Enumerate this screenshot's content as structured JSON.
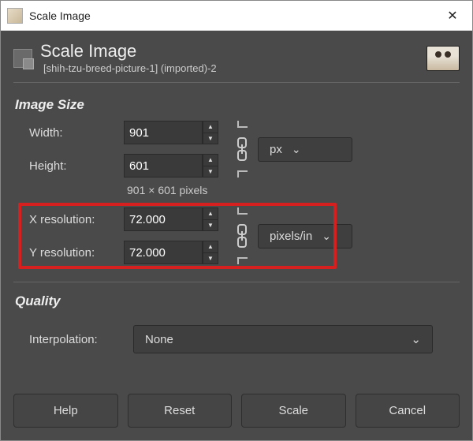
{
  "window": {
    "title": "Scale Image",
    "close_glyph": "✕"
  },
  "header": {
    "title": "Scale Image",
    "subtitle": "[shih-tzu-breed-picture-1] (imported)-2"
  },
  "image_size": {
    "section_label": "Image Size",
    "width_label": "Width:",
    "height_label": "Height:",
    "width_value": "901",
    "height_value": "601",
    "unit": "px",
    "dims_text": "901 × 601 pixels"
  },
  "resolution": {
    "x_label": "X resolution:",
    "y_label": "Y resolution:",
    "x_value": "72.000",
    "y_value": "72.000",
    "unit": "pixels/in"
  },
  "quality": {
    "section_label": "Quality",
    "interpolation_label": "Interpolation:",
    "interpolation_value": "None"
  },
  "buttons": {
    "help": "Help",
    "reset": "Reset",
    "scale": "Scale",
    "cancel": "Cancel"
  },
  "glyphs": {
    "chevron_down": "⌄",
    "arrow_up": "▲",
    "arrow_down": "▼"
  }
}
